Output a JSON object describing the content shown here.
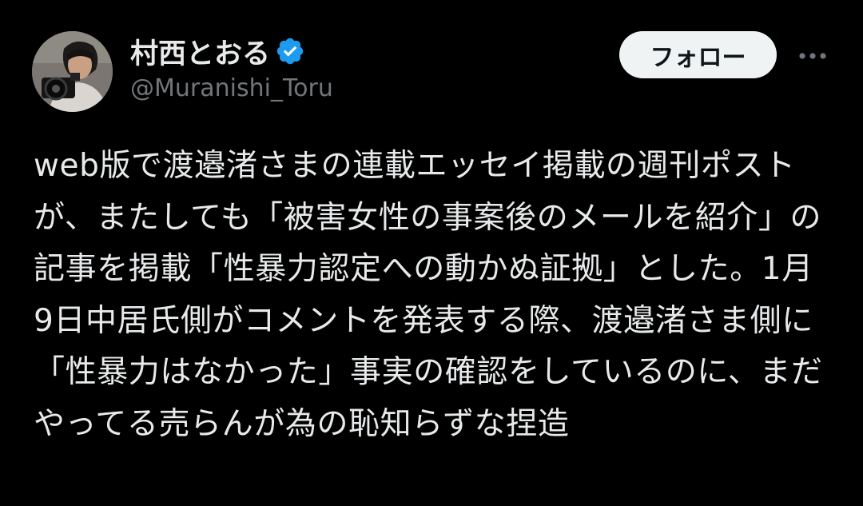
{
  "author": {
    "display_name": "村西とおる",
    "handle": "@Muranishi_Toru",
    "verified": true
  },
  "actions": {
    "follow_label": "フォロー",
    "more_icon": "more-horizontal-icon"
  },
  "post": {
    "text": "web版で渡邉渚さまの連載エッセイ掲載の週刊ポストが、またしても「被害女性の事案後のメールを紹介」の記事を掲載「性暴力認定への動かぬ証拠」とした。1月9日中居氏側がコメントを発表する際、渡邉渚さま側に「性暴力はなかった」事実の確認をしているのに、まだやってる売らんが為の恥知らずな捏造"
  },
  "colors": {
    "background": "#000000",
    "text_primary": "#e7e9ea",
    "text_secondary": "#71767b",
    "verified_badge": "#1d9bf0",
    "follow_button_bg": "#eff3f4",
    "follow_button_text": "#0f1419"
  }
}
